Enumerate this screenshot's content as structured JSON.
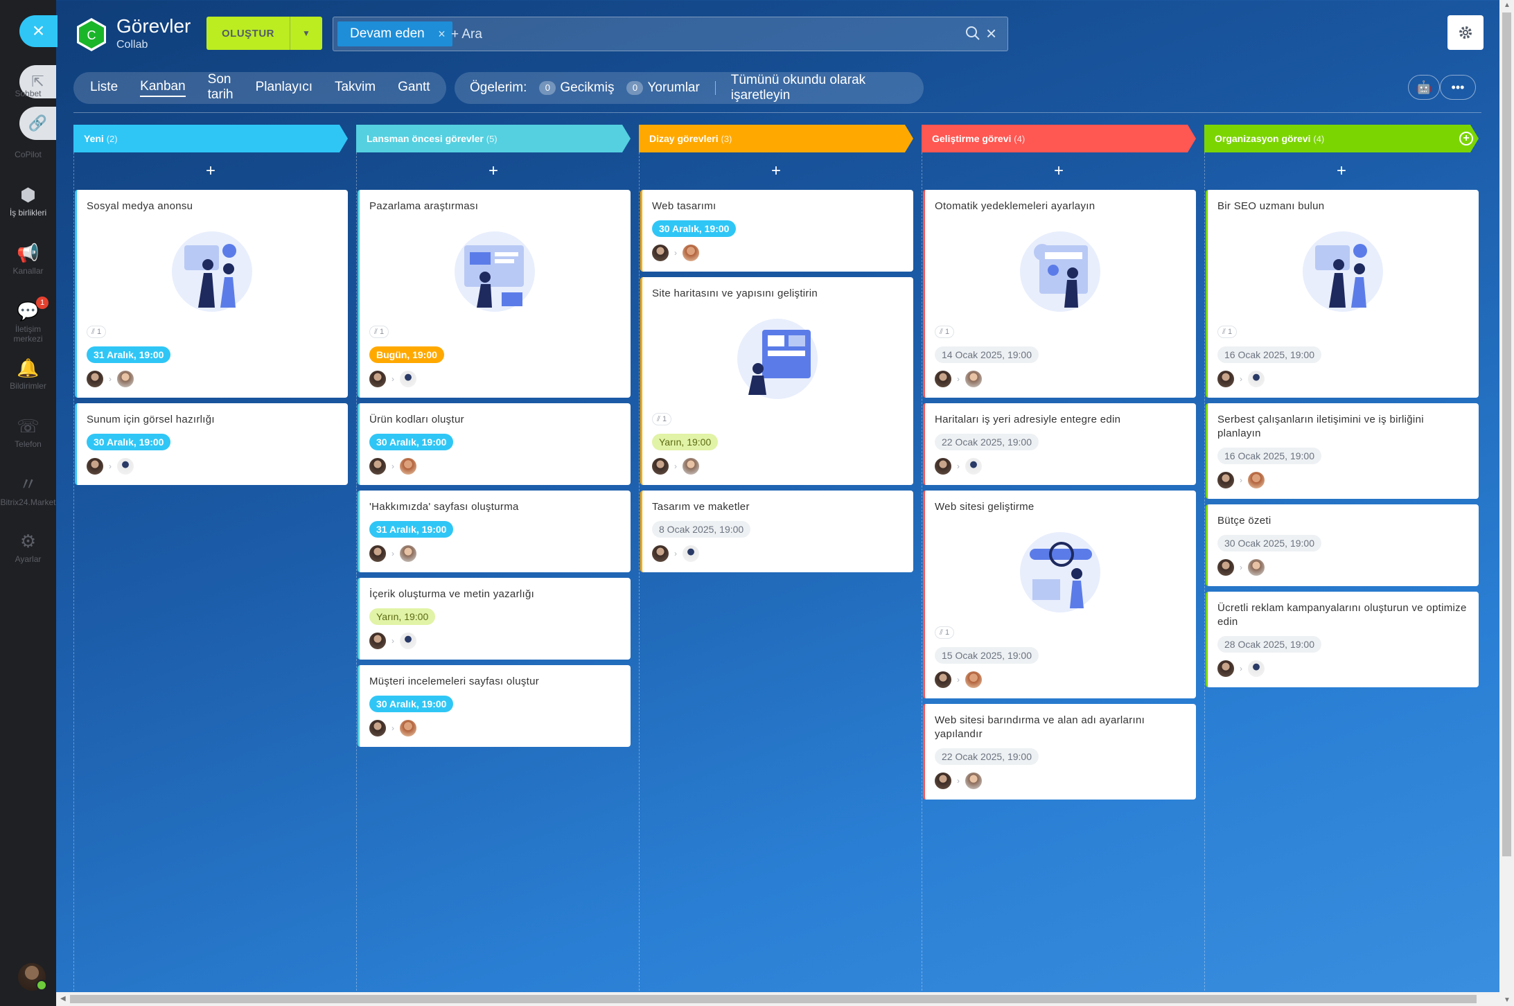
{
  "sidebar": {
    "items": [
      {
        "label": "Sohbet",
        "icon": "external-link-icon"
      },
      {
        "label": "CoPilot",
        "icon": "link-icon"
      },
      {
        "label": "İş birlikleri",
        "icon": "hexagon-icon"
      },
      {
        "label": "Kanallar",
        "icon": "megaphone-icon"
      },
      {
        "label": "İletişim merkezi",
        "icon": "chat-icon",
        "badge": "1"
      },
      {
        "label": "Bildirimler",
        "icon": "bell-icon"
      },
      {
        "label": "Telefon",
        "icon": "phone-icon"
      },
      {
        "label": "Bitrix24.Market",
        "icon": "market-icon"
      },
      {
        "label": "Ayarlar",
        "icon": "gear-icon"
      }
    ]
  },
  "header": {
    "logo_letter": "C",
    "title": "Görevler",
    "subtitle": "Collab",
    "create_label": "OLUŞTUR",
    "search_chip": "Devam eden",
    "search_placeholder": "+ Ara"
  },
  "views": [
    "Liste",
    "Kanban",
    "Son tarih",
    "Planlayıcı",
    "Takvim",
    "Gantt"
  ],
  "active_view": "Kanban",
  "counters": {
    "label": "Ögelerim:",
    "overdue_count": "0",
    "overdue_label": "Gecikmiş",
    "comments_count": "0",
    "comments_label": "Yorumlar",
    "mark_read": "Tümünü okundu olarak işaretleyin"
  },
  "colors": {
    "col1": "#2fc6f6",
    "col2": "#55d0e0",
    "col3": "#ffa900",
    "col4": "#ff5752",
    "col5": "#7bd500",
    "accent": "#bbed21"
  },
  "columns": [
    {
      "title": "Yeni",
      "count": "(2)",
      "cards": [
        {
          "title": "Sosyal medya anonsu",
          "illus": true,
          "att": "1",
          "deadline": "31 Aralık, 19:00",
          "style": "blue"
        },
        {
          "title": "Sunum için görsel hazırlığı",
          "deadline": "30 Aralık, 19:00",
          "style": "blue"
        }
      ]
    },
    {
      "title": "Lansman öncesi görevler",
      "count": "(5)",
      "cards": [
        {
          "title": "Pazarlama araştırması",
          "illus": true,
          "att": "1",
          "deadline": "Bugün, 19:00",
          "style": "orange"
        },
        {
          "title": "Ürün kodları oluştur",
          "deadline": "30 Aralık, 19:00",
          "style": "blue"
        },
        {
          "title": "'Hakkımızda' sayfası oluşturma",
          "deadline": "31 Aralık, 19:00",
          "style": "blue"
        },
        {
          "title": "İçerik oluşturma ve metin yazarlığı",
          "deadline": "Yarın, 19:00",
          "style": "green"
        },
        {
          "title": "Müşteri incelemeleri sayfası oluştur",
          "deadline": "30 Aralık, 19:00",
          "style": "blue"
        }
      ]
    },
    {
      "title": "Dizay görevleri",
      "count": "(3)",
      "cards": [
        {
          "title": "Web tasarımı",
          "deadline": "30 Aralık, 19:00",
          "style": "blue"
        },
        {
          "title": "Site haritasını ve yapısını geliştirin",
          "illus": true,
          "att": "1",
          "deadline": "Yarın, 19:00",
          "style": "green"
        },
        {
          "title": "Tasarım ve maketler",
          "deadline": "8 Ocak 2025, 19:00",
          "style": "grey"
        }
      ]
    },
    {
      "title": "Geliştirme görevi",
      "count": "(4)",
      "cards": [
        {
          "title": "Otomatik yedeklemeleri ayarlayın",
          "illus": true,
          "att": "1",
          "deadline": "14 Ocak 2025, 19:00",
          "style": "grey"
        },
        {
          "title": "Haritaları iş yeri adresiyle entegre edin",
          "deadline": "22 Ocak 2025, 19:00",
          "style": "grey"
        },
        {
          "title": "Web sitesi geliştirme",
          "illus": true,
          "att": "1",
          "deadline": "15 Ocak 2025, 19:00",
          "style": "grey"
        },
        {
          "title": "Web sitesi barındırma ve alan adı ayarlarını yapılandır",
          "deadline": "22 Ocak 2025, 19:00",
          "style": "grey"
        }
      ]
    },
    {
      "title": "Organizasyon görevi",
      "count": "(4)",
      "cards": [
        {
          "title": "Bir SEO uzmanı bulun",
          "illus": true,
          "att": "1",
          "deadline": "16 Ocak 2025, 19:00",
          "style": "grey"
        },
        {
          "title": "Serbest çalışanların iletişimini ve iş birliğini planlayın",
          "deadline": "16 Ocak 2025, 19:00",
          "style": "grey"
        },
        {
          "title": "Bütçe özeti",
          "deadline": "30 Ocak 2025, 19:00",
          "style": "grey"
        },
        {
          "title": "Ücretli reklam kampanyalarını oluşturun ve optimize edin",
          "deadline": "28 Ocak 2025, 19:00",
          "style": "grey"
        }
      ]
    }
  ]
}
